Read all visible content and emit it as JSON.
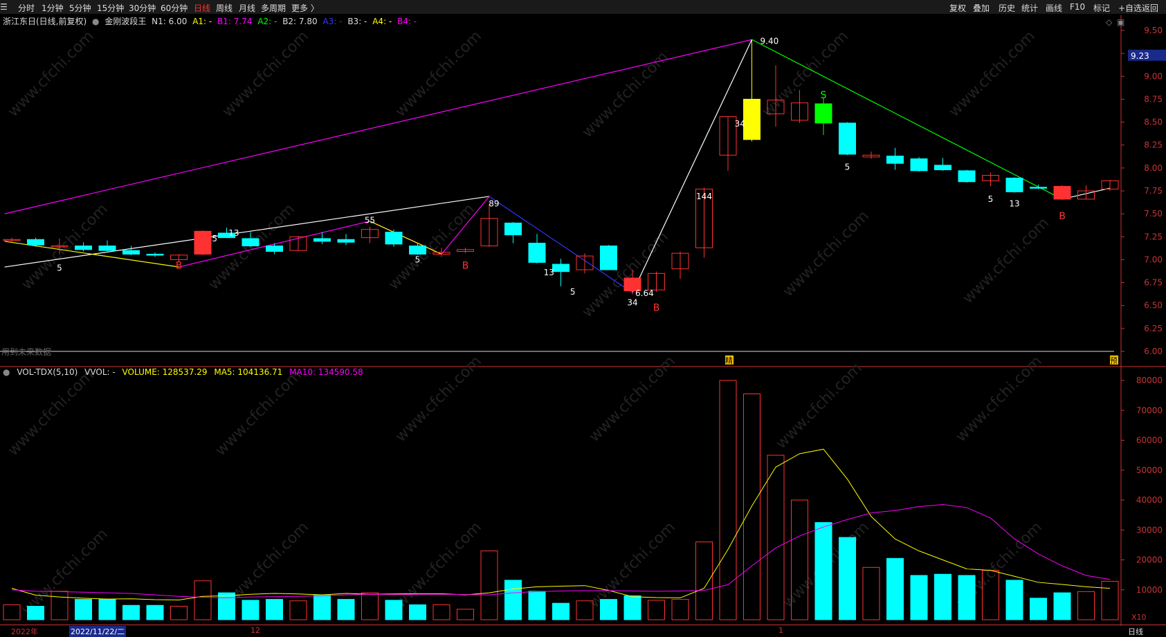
{
  "topbar": {
    "menu_icon": "☰",
    "periods": [
      "分时",
      "1分钟",
      "5分钟",
      "15分钟",
      "30分钟",
      "60分钟",
      "日线",
      "周线",
      "月线",
      "多周期",
      "更多 〉"
    ],
    "active_period": "日线",
    "tools": [
      "复权",
      "叠加",
      "历史",
      "统计",
      "画线",
      "F10",
      "标记",
      "+自选",
      "返回"
    ]
  },
  "header": {
    "stock": "浙江东日(日线,前复权)",
    "indicator": "金刚波段王",
    "n1": "N1: 6.00",
    "a1": "A1: -",
    "b1": "B1: 7.74",
    "a2": "A2: -",
    "b2": "B2: 7.80",
    "a3": "A3: -",
    "b3": "B3: -",
    "a4": "A4: -",
    "b4": "B4: -"
  },
  "vol_header": {
    "name": "VOL-TDX(5,10)",
    "vvol": "VVOL: -",
    "volume": "VOLUME: 128537.29",
    "ma5": "MA5: 104136.71",
    "ma10": "MA10: 134590.58"
  },
  "price_axis": {
    "ticks": [
      "9.50",
      "9.25",
      "9.00",
      "8.75",
      "8.50",
      "8.25",
      "8.00",
      "7.75",
      "7.50",
      "7.25",
      "7.00",
      "6.75",
      "6.50",
      "6.25",
      "6.00"
    ],
    "current": "9.23"
  },
  "vol_axis": {
    "ticks": [
      "80000",
      "70000",
      "60000",
      "50000",
      "40000",
      "30000",
      "20000",
      "10000"
    ],
    "unit": "X10"
  },
  "future_note": "用到未来数据",
  "markers": {
    "future1": "精",
    "future2": "预"
  },
  "bottombar": {
    "year": "2022年",
    "cursor_date": "2022/11/22/二",
    "m12": "12",
    "m1": "1",
    "period": "日线"
  },
  "annotations": {
    "high": "9.40",
    "low": "6.64"
  },
  "colors": {
    "up": "#ff3232",
    "down": "#00ffff",
    "yellow": "#ffff00",
    "magenta": "#ff00ff",
    "green": "#00ff00",
    "blue": "#3333ff",
    "white": "#ffffff"
  },
  "chart_data": {
    "type": "candlestick",
    "price_ylim": [
      6.0,
      9.5
    ],
    "vol_ylim": [
      0,
      80000
    ],
    "candles": [
      {
        "o": 7.21,
        "h": 7.24,
        "l": 7.19,
        "c": 7.22,
        "v": 5000
      },
      {
        "o": 7.22,
        "h": 7.24,
        "l": 7.14,
        "c": 7.16,
        "v": 4500
      },
      {
        "o": 7.15,
        "h": 7.23,
        "l": 7.06,
        "c": 7.15,
        "v": 9500
      },
      {
        "o": 7.15,
        "h": 7.19,
        "l": 7.09,
        "c": 7.11,
        "v": 6800
      },
      {
        "o": 7.15,
        "h": 7.21,
        "l": 7.09,
        "c": 7.1,
        "v": 6800
      },
      {
        "o": 7.1,
        "h": 7.15,
        "l": 7.05,
        "c": 7.06,
        "v": 4800
      },
      {
        "o": 7.06,
        "h": 7.08,
        "l": 7.03,
        "c": 7.05,
        "v": 4800
      },
      {
        "o": 7.0,
        "h": 7.06,
        "l": 6.98,
        "c": 7.05,
        "v": 4500
      },
      {
        "o": 7.06,
        "h": 7.32,
        "l": 7.05,
        "c": 7.31,
        "v": 13000
      },
      {
        "o": 7.29,
        "h": 7.35,
        "l": 7.25,
        "c": 7.24,
        "v": 9000
      },
      {
        "o": 7.23,
        "h": 7.3,
        "l": 7.14,
        "c": 7.15,
        "v": 6500
      },
      {
        "o": 7.15,
        "h": 7.18,
        "l": 7.06,
        "c": 7.09,
        "v": 6800
      },
      {
        "o": 7.1,
        "h": 7.26,
        "l": 7.1,
        "c": 7.25,
        "v": 6300
      },
      {
        "o": 7.23,
        "h": 7.3,
        "l": 7.17,
        "c": 7.2,
        "v": 8200
      },
      {
        "o": 7.22,
        "h": 7.28,
        "l": 7.16,
        "c": 7.19,
        "v": 6800
      },
      {
        "o": 7.24,
        "h": 7.36,
        "l": 7.18,
        "c": 7.33,
        "v": 9000
      },
      {
        "o": 7.3,
        "h": 7.33,
        "l": 7.14,
        "c": 7.17,
        "v": 6500
      },
      {
        "o": 7.15,
        "h": 7.18,
        "l": 7.05,
        "c": 7.06,
        "v": 5000
      },
      {
        "o": 7.06,
        "h": 7.13,
        "l": 7.03,
        "c": 7.08,
        "v": 5000
      },
      {
        "o": 7.09,
        "h": 7.13,
        "l": 7.07,
        "c": 7.11,
        "v": 3500
      },
      {
        "o": 7.15,
        "h": 7.61,
        "l": 7.14,
        "c": 7.45,
        "v": 23000
      },
      {
        "o": 7.4,
        "h": 7.41,
        "l": 7.18,
        "c": 7.27,
        "v": 13200
      },
      {
        "o": 7.18,
        "h": 7.28,
        "l": 6.96,
        "c": 6.97,
        "v": 9500
      },
      {
        "o": 6.95,
        "h": 7.01,
        "l": 6.71,
        "c": 6.87,
        "v": 5500
      },
      {
        "o": 6.89,
        "h": 7.07,
        "l": 6.85,
        "c": 7.04,
        "v": 6300
      },
      {
        "o": 7.15,
        "h": 7.16,
        "l": 6.89,
        "c": 6.89,
        "v": 6800
      },
      {
        "o": 6.8,
        "h": 6.89,
        "l": 6.62,
        "c": 6.66,
        "v": 8000
      },
      {
        "o": 6.67,
        "h": 6.87,
        "l": 6.65,
        "c": 6.85,
        "v": 6500
      },
      {
        "o": 6.9,
        "h": 7.09,
        "l": 6.79,
        "c": 7.07,
        "v": 6800
      },
      {
        "o": 7.13,
        "h": 7.79,
        "l": 7.02,
        "c": 7.77,
        "v": 26000
      },
      {
        "o": 8.14,
        "h": 8.56,
        "l": 7.97,
        "c": 8.56,
        "v": 80000
      },
      {
        "o": 8.31,
        "h": 9.4,
        "l": 8.29,
        "c": 8.75,
        "v": 75500
      },
      {
        "o": 8.59,
        "h": 9.12,
        "l": 8.45,
        "c": 8.74,
        "v": 55000
      },
      {
        "o": 8.52,
        "h": 8.85,
        "l": 8.49,
        "c": 8.71,
        "v": 40000
      },
      {
        "o": 8.7,
        "h": 8.77,
        "l": 8.36,
        "c": 8.49,
        "v": 32500
      },
      {
        "o": 8.49,
        "h": 8.5,
        "l": 8.14,
        "c": 8.15,
        "v": 27500
      },
      {
        "o": 8.12,
        "h": 8.18,
        "l": 8.1,
        "c": 8.14,
        "v": 17500
      },
      {
        "o": 8.13,
        "h": 8.22,
        "l": 7.98,
        "c": 8.05,
        "v": 20500
      },
      {
        "o": 8.1,
        "h": 8.12,
        "l": 7.96,
        "c": 7.97,
        "v": 14800
      },
      {
        "o": 8.03,
        "h": 8.11,
        "l": 7.97,
        "c": 7.98,
        "v": 15200
      },
      {
        "o": 7.97,
        "h": 7.98,
        "l": 7.84,
        "c": 7.85,
        "v": 14800
      },
      {
        "o": 7.86,
        "h": 7.95,
        "l": 7.8,
        "c": 7.92,
        "v": 16500
      },
      {
        "o": 7.89,
        "h": 7.9,
        "l": 7.73,
        "c": 7.74,
        "v": 13200
      },
      {
        "o": 7.79,
        "h": 7.82,
        "l": 7.77,
        "c": 7.78,
        "v": 7200
      },
      {
        "o": 7.8,
        "h": 7.81,
        "l": 7.65,
        "c": 7.66,
        "v": 9000
      },
      {
        "o": 7.66,
        "h": 7.81,
        "l": 7.66,
        "c": 7.75,
        "v": 9400
      },
      {
        "o": 7.77,
        "h": 7.87,
        "l": 7.75,
        "c": 7.86,
        "v": 12853
      }
    ],
    "signal_candles": {
      "red": [
        8,
        26,
        44
      ],
      "yellow": 31,
      "green": 34
    },
    "ma5": [
      10500,
      8200,
      7600,
      7200,
      6900,
      7000,
      6700,
      6600,
      7800,
      8000,
      8500,
      8800,
      8600,
      8300,
      8800,
      8500,
      8600,
      8700,
      8700,
      8300,
      9000,
      10300,
      11000,
      11200,
      11400,
      9800,
      7700,
      7400,
      7300,
      10500,
      23500,
      38000,
      51000,
      55500,
      57000,
      47000,
      34500,
      27000,
      23000,
      20000,
      17000,
      16500,
      14500,
      12500,
      11800,
      11000,
      10500
    ],
    "ma10": [
      10000,
      9500,
      9400,
      9200,
      9000,
      8800,
      8300,
      7800,
      7500,
      7300,
      7600,
      7700,
      7800,
      8000,
      8300,
      8500,
      8400,
      8500,
      8500,
      8400,
      8300,
      9000,
      9400,
      9600,
      9700,
      9700,
      9600,
      9500,
      9600,
      9800,
      11700,
      18000,
      24000,
      28000,
      31000,
      33500,
      35700,
      36500,
      37800,
      38500,
      37500,
      34000,
      27000,
      22000,
      18000,
      14800,
      13459
    ]
  }
}
